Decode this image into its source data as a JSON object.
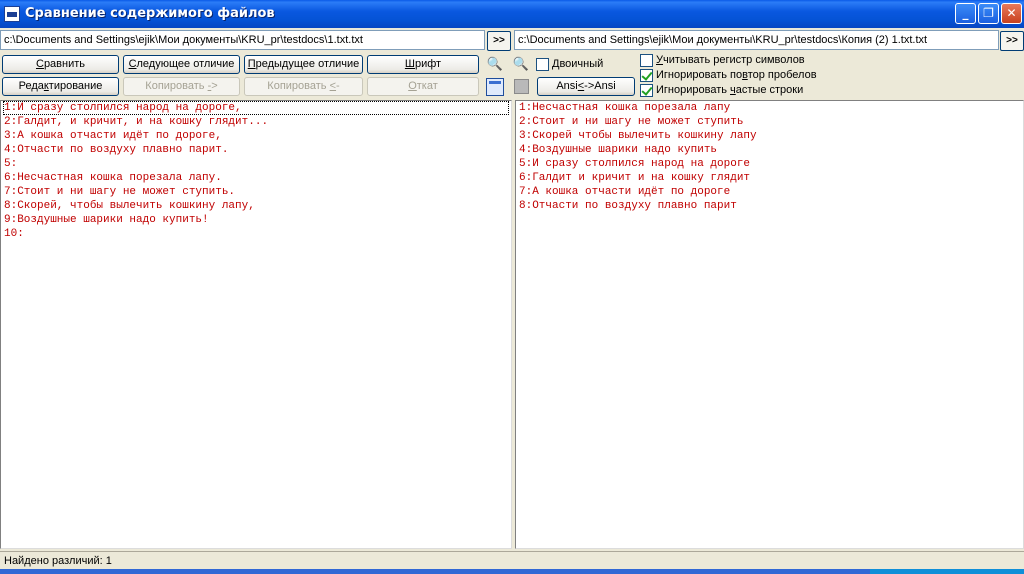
{
  "window": {
    "title": "Сравнение содержимого файлов",
    "minimize_label": "_",
    "maximize_label": "❐",
    "close_label": "✕"
  },
  "paths": {
    "left": "c:\\Documents and Settings\\ejik\\Мои документы\\KRU_pr\\testdocs\\1.txt.txt",
    "right": "c:\\Documents and Settings\\ejik\\Мои документы\\KRU_pr\\testdocs\\Копия (2) 1.txt.txt",
    "browse_label": ">>"
  },
  "toolbar": {
    "compare": {
      "pre": "",
      "u": "С",
      "post": "равнить"
    },
    "next_diff": {
      "pre": "",
      "u": "С",
      "post": "ледующее отличие"
    },
    "prev_diff": {
      "pre": "",
      "u": "П",
      "post": "редыдущее отличие"
    },
    "font": {
      "pre": "",
      "u": "Ш",
      "post": "рифт"
    },
    "edit": {
      "pre": "Реда",
      "u": "к",
      "post": "тирование"
    },
    "copy_right": {
      "pre": "Копировать ",
      "u": "-",
      "post": ">"
    },
    "copy_left": {
      "pre": "Копировать ",
      "u": "<",
      "post": "-"
    },
    "rollback": {
      "pre": "",
      "u": "О",
      "post": "ткат"
    },
    "binary_label": "Двоичный",
    "ansi_label": "Ansi<->Ansi",
    "ansi_pre": "Ansi",
    "ansi_u": "<",
    "ansi_post": "->Ansi"
  },
  "options": [
    {
      "pre": "",
      "u": "У",
      "post": "читывать регистр символов",
      "checked": false
    },
    {
      "pre": "Игнорировать по",
      "u": "в",
      "post": "тор пробелов",
      "checked": true
    },
    {
      "pre": "Игнорировать ",
      "u": "ч",
      "post": "астые строки",
      "checked": true
    }
  ],
  "left_lines": [
    "1:И сразу столпился народ на дороге,",
    "2:Галдит, и кричит, и на кошку глядит...",
    "3:А кошка отчасти идёт по дороге,",
    "4:Отчасти по воздуху плавно парит.",
    "5:",
    "6:Несчастная кошка порезала лапу.",
    "7:Стоит и ни шагу не может ступить.",
    "8:Скорей, чтобы вылечить кошкину лапу,",
    "9:Воздушные шарики надо купить!",
    "10:"
  ],
  "right_lines": [
    "1:Несчастная кошка порезала лапу",
    "2:Стоит и ни шагу не может ступить",
    "3:Скорей чтобы вылечить кошкину лапу",
    "4:Воздушные шарики надо купить",
    "5:И сразу столпился народ на дороге",
    "6:Галдит и кричит и на кошку глядит",
    "7:А кошка отчасти идёт по дороге",
    "8:Отчасти по воздуху плавно парит"
  ],
  "status": "Найдено различий: 1"
}
